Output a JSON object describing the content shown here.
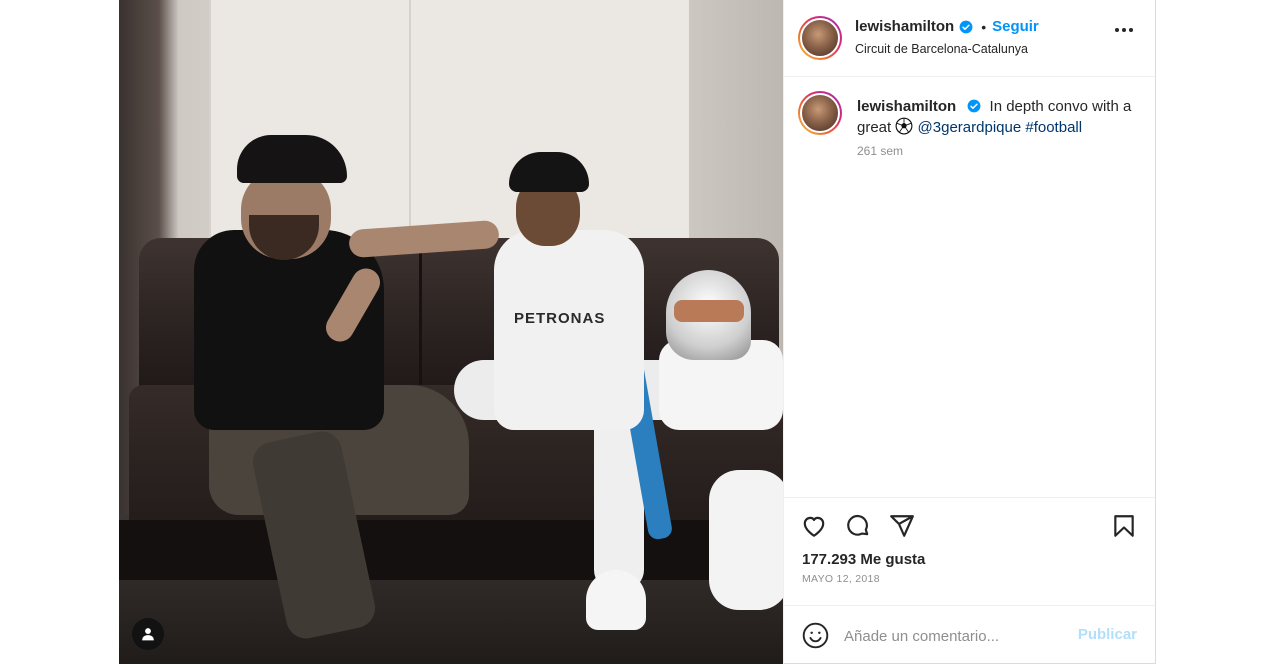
{
  "post": {
    "username": "lewishamilton",
    "follow_label": "Seguir",
    "separator": "•",
    "location": "Circuit de Barcelona-Catalunya",
    "photo_print": "PETRONAS"
  },
  "caption": {
    "username": "lewishamilton",
    "text_before": "In depth convo with a great",
    "emoji": "soccer-ball-icon",
    "mention": "@3gerardpique",
    "hashtag": "#football",
    "age": "261 sem"
  },
  "stats": {
    "likes": "177.293 Me gusta",
    "date": "MAYO 12, 2018"
  },
  "comment_box": {
    "placeholder": "Añade un comentario...",
    "publish_label": "Publicar"
  },
  "icons": [
    "verified-badge-icon",
    "more-options-icon",
    "heart-icon",
    "comment-icon",
    "share-icon",
    "bookmark-icon",
    "emoji-icon",
    "user-tag-icon"
  ],
  "colors": {
    "accent": "#0095f6",
    "link": "#00376b",
    "muted": "#8e8e8e",
    "publish_disabled": "#b2dffc"
  }
}
